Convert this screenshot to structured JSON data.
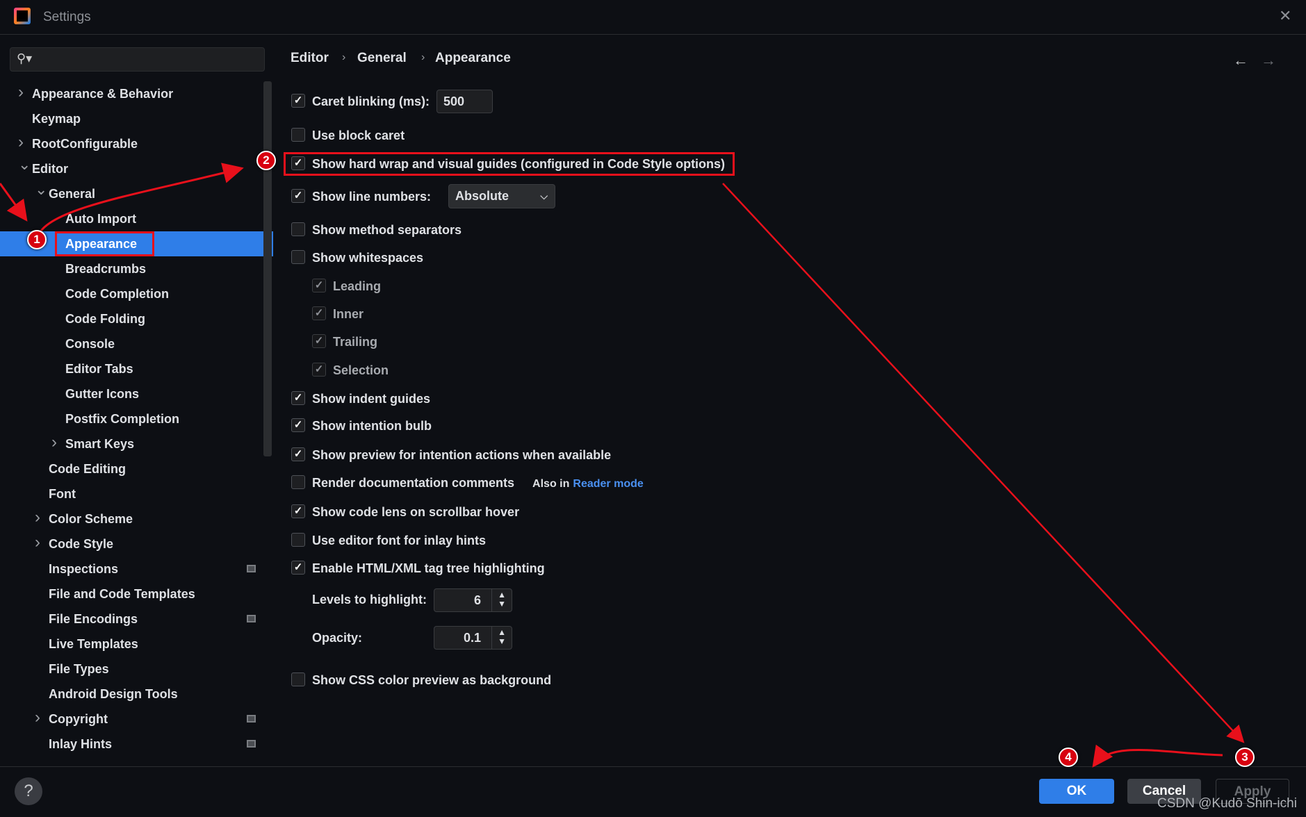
{
  "window": {
    "title": "Settings",
    "close_icon": "close-icon"
  },
  "search": {
    "placeholder": ""
  },
  "sidebar": {
    "items": [
      {
        "label": "Appearance & Behavior",
        "level": 0,
        "chevron": "right"
      },
      {
        "label": "Keymap",
        "level": 0,
        "chevron": ""
      },
      {
        "label": "RootConfigurable",
        "level": 0,
        "chevron": "right"
      },
      {
        "label": "Editor",
        "level": 0,
        "chevron": "down"
      },
      {
        "label": "General",
        "level": 1,
        "chevron": "down"
      },
      {
        "label": "Auto Import",
        "level": 2,
        "chevron": ""
      },
      {
        "label": "Appearance",
        "level": 2,
        "chevron": "",
        "selected": true
      },
      {
        "label": "Breadcrumbs",
        "level": 2,
        "chevron": ""
      },
      {
        "label": "Code Completion",
        "level": 2,
        "chevron": ""
      },
      {
        "label": "Code Folding",
        "level": 2,
        "chevron": ""
      },
      {
        "label": "Console",
        "level": 2,
        "chevron": ""
      },
      {
        "label": "Editor Tabs",
        "level": 2,
        "chevron": ""
      },
      {
        "label": "Gutter Icons",
        "level": 2,
        "chevron": ""
      },
      {
        "label": "Postfix Completion",
        "level": 2,
        "chevron": ""
      },
      {
        "label": "Smart Keys",
        "level": 2,
        "chevron": "right"
      },
      {
        "label": "Code Editing",
        "level": 1,
        "chevron": ""
      },
      {
        "label": "Font",
        "level": 1,
        "chevron": ""
      },
      {
        "label": "Color Scheme",
        "level": 1,
        "chevron": "right"
      },
      {
        "label": "Code Style",
        "level": 1,
        "chevron": "right"
      },
      {
        "label": "Inspections",
        "level": 1,
        "chevron": "",
        "project_icon": true
      },
      {
        "label": "File and Code Templates",
        "level": 1,
        "chevron": ""
      },
      {
        "label": "File Encodings",
        "level": 1,
        "chevron": "",
        "project_icon": true
      },
      {
        "label": "Live Templates",
        "level": 1,
        "chevron": ""
      },
      {
        "label": "File Types",
        "level": 1,
        "chevron": ""
      },
      {
        "label": "Android Design Tools",
        "level": 1,
        "chevron": ""
      },
      {
        "label": "Copyright",
        "level": 1,
        "chevron": "right",
        "project_icon": true
      },
      {
        "label": "Inlay Hints",
        "level": 1,
        "chevron": "",
        "project_icon": true
      }
    ]
  },
  "breadcrumb": [
    "Editor",
    "General",
    "Appearance"
  ],
  "options": {
    "caret_blinking": {
      "label": "Caret blinking (ms):",
      "checked": true,
      "value": "500"
    },
    "block_caret": {
      "label": "Use block caret",
      "checked": false
    },
    "hard_wrap": {
      "label": "Show hard wrap and visual guides (configured in Code Style options)",
      "checked": true
    },
    "line_numbers": {
      "label": "Show line numbers:",
      "checked": true,
      "value": "Absolute"
    },
    "method_separators": {
      "label": "Show method separators",
      "checked": false
    },
    "whitespaces": {
      "label": "Show whitespaces",
      "checked": false
    },
    "leading": {
      "label": "Leading",
      "checked": true
    },
    "inner": {
      "label": "Inner",
      "checked": true
    },
    "trailing": {
      "label": "Trailing",
      "checked": true
    },
    "selection": {
      "label": "Selection",
      "checked": true
    },
    "indent_guides": {
      "label": "Show indent guides",
      "checked": true
    },
    "intention_bulb": {
      "label": "Show intention bulb",
      "checked": true
    },
    "preview_intention": {
      "label": "Show preview for intention actions when available",
      "checked": true
    },
    "render_docs": {
      "label": "Render documentation comments",
      "checked": false,
      "also_in": "Also in",
      "link": "Reader mode"
    },
    "code_lens": {
      "label": "Show code lens on scrollbar hover",
      "checked": true
    },
    "editor_font_inlay": {
      "label": "Use editor font for inlay hints",
      "checked": false
    },
    "tag_tree": {
      "label": "Enable HTML/XML tag tree highlighting",
      "checked": true
    },
    "levels": {
      "label": "Levels to highlight:",
      "value": "6"
    },
    "opacity": {
      "label": "Opacity:",
      "value": "0.1"
    },
    "css_preview": {
      "label": "Show CSS color preview as background",
      "checked": false
    }
  },
  "footer": {
    "help": "?",
    "ok": "OK",
    "cancel": "Cancel",
    "apply": "Apply"
  },
  "annotations": [
    "1",
    "2",
    "3",
    "4"
  ],
  "watermark": "CSDN @Kudō Shin-ichi",
  "colors": {
    "accent": "#2f7ee8",
    "background": "#0d0f14",
    "annotation": "#e8101b"
  }
}
